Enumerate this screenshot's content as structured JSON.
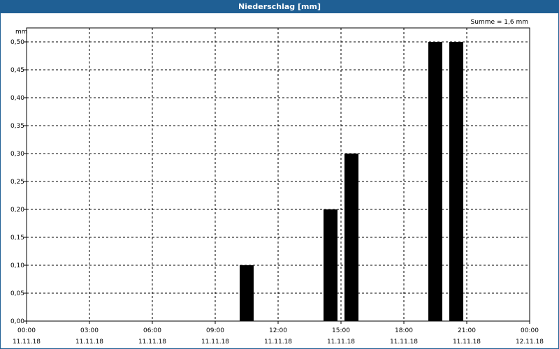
{
  "window": {
    "title": "Niederschlag [mm]"
  },
  "chart_data": {
    "type": "bar",
    "title": "Niederschlag [mm]",
    "ylabel": "mm",
    "annotation": "Summe = 1,6 mm",
    "ylim": [
      0,
      0.5
    ],
    "yticks": [
      "0,00",
      "0,05",
      "0,10",
      "0,15",
      "0,20",
      "0,25",
      "0,30",
      "0,35",
      "0,40",
      "0,45",
      "0,50"
    ],
    "xrange_hours": [
      0,
      24
    ],
    "xticks": [
      {
        "time": "00:00",
        "date": "11.11.18",
        "hour": 0
      },
      {
        "time": "03:00",
        "date": "11.11.18",
        "hour": 3
      },
      {
        "time": "06:00",
        "date": "11.11.18",
        "hour": 6
      },
      {
        "time": "09:00",
        "date": "11.11.18",
        "hour": 9
      },
      {
        "time": "12:00",
        "date": "11.11.18",
        "hour": 12
      },
      {
        "time": "15:00",
        "date": "11.11.18",
        "hour": 15
      },
      {
        "time": "18:00",
        "date": "11.11.18",
        "hour": 18
      },
      {
        "time": "21:00",
        "date": "11.11.18",
        "hour": 21
      },
      {
        "time": "00:00",
        "date": "12.11.18",
        "hour": 24
      }
    ],
    "bars": [
      {
        "hour": 10.5,
        "value": 0.1
      },
      {
        "hour": 14.5,
        "value": 0.2
      },
      {
        "hour": 15.5,
        "value": 0.3
      },
      {
        "hour": 19.5,
        "value": 0.5
      },
      {
        "hour": 20.5,
        "value": 0.5
      }
    ],
    "grid": true,
    "bar_color": "#000000"
  }
}
